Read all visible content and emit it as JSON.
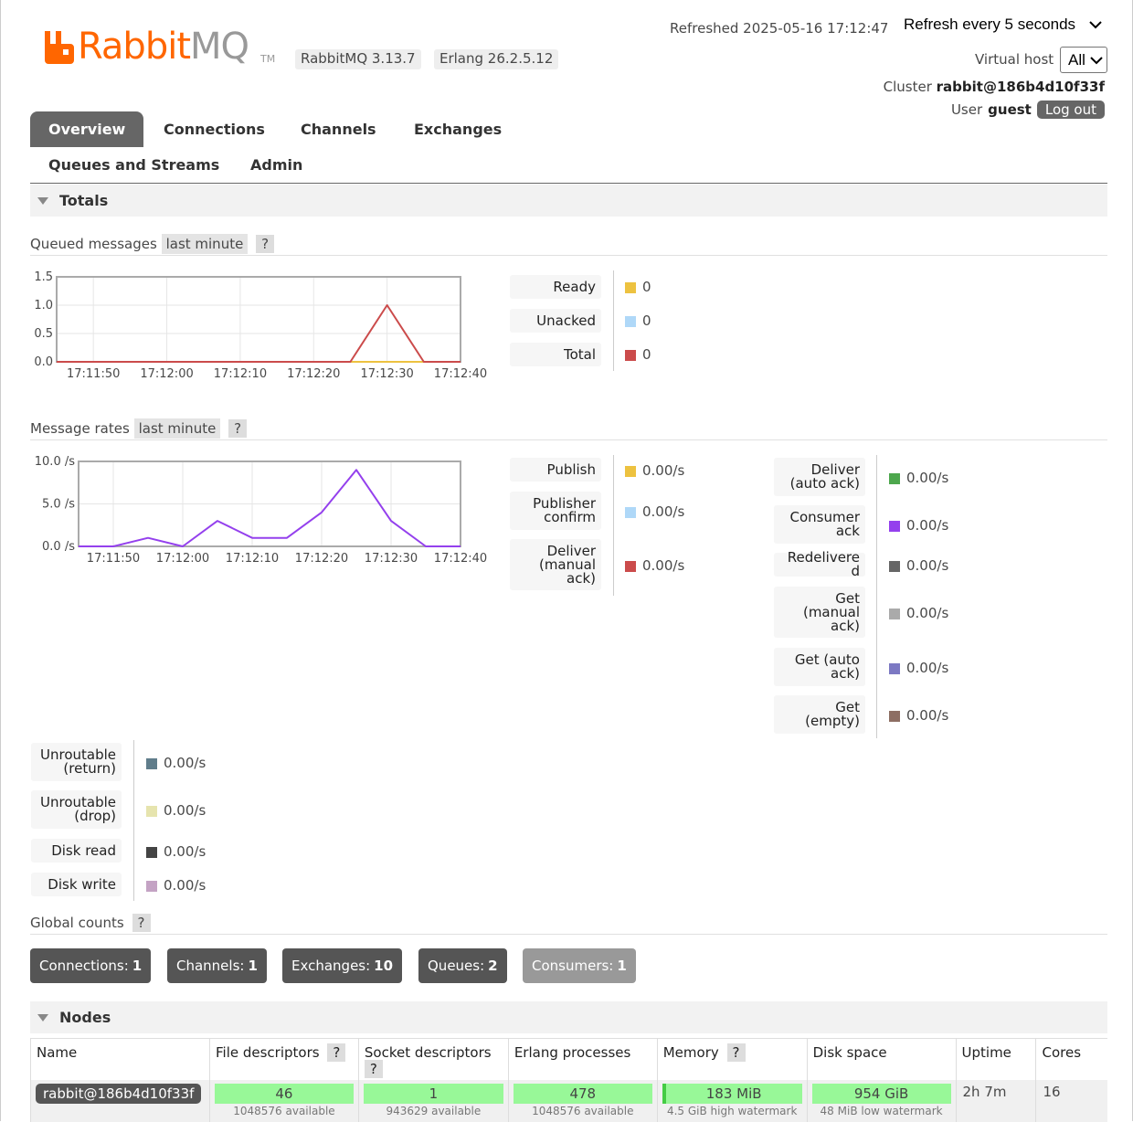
{
  "header": {
    "brand_word1": "Rabbit",
    "brand_word2": "MQ",
    "brand_tm": "TM",
    "rabbitmq_version": "RabbitMQ 3.13.7",
    "erlang_version": "Erlang 26.2.5.12",
    "refreshed_label": "Refreshed 2025-05-16 17:12:47",
    "refresh_option": "Refresh every 5 seconds",
    "vhost_label": "Virtual host",
    "vhost_value": "All",
    "cluster_label": "Cluster",
    "cluster_value": "rabbit@186b4d10f33f",
    "user_label": "User",
    "user_value": "guest",
    "logout_label": "Log out",
    "brand_color": "#ff6600"
  },
  "tabs": [
    {
      "label": "Overview",
      "active": true
    },
    {
      "label": "Connections",
      "active": false
    },
    {
      "label": "Channels",
      "active": false
    },
    {
      "label": "Exchanges",
      "active": false
    },
    {
      "label": "Queues and Streams",
      "active": false
    },
    {
      "label": "Admin",
      "active": false
    }
  ],
  "totals": {
    "title": "Totals",
    "queued": {
      "label": "Queued messages",
      "range": "last minute",
      "help": "?",
      "legend": [
        {
          "label": "Ready",
          "value": "0",
          "color": "#edc240"
        },
        {
          "label": "Unacked",
          "value": "0",
          "color": "#afd8f8"
        },
        {
          "label": "Total",
          "value": "0",
          "color": "#cb4b4b"
        }
      ]
    },
    "rates": {
      "label": "Message rates",
      "range": "last minute",
      "help": "?",
      "legend_left": [
        {
          "label": "Publish",
          "value": "0.00/s",
          "color": "#edc240"
        },
        {
          "label": "Publisher confirm",
          "value": "0.00/s",
          "color": "#afd8f8"
        },
        {
          "label": "Deliver (manual ack)",
          "value": "0.00/s",
          "color": "#cb4b4b"
        }
      ],
      "legend_right": [
        {
          "label": "Deliver (auto ack)",
          "value": "0.00/s",
          "color": "#4da74d"
        },
        {
          "label": "Consumer ack",
          "value": "0.00/s",
          "color": "#9440ed"
        },
        {
          "label": "Redelivered",
          "value": "0.00/s",
          "color": "#666666"
        },
        {
          "label": "Get (manual ack)",
          "value": "0.00/s",
          "color": "#aaaaaa"
        },
        {
          "label": "Get (auto ack)",
          "value": "0.00/s",
          "color": "#7c79c3"
        },
        {
          "label": "Get (empty)",
          "value": "0.00/s",
          "color": "#8d6e63"
        }
      ],
      "legend_bottom": [
        {
          "label": "Unroutable (return)",
          "value": "0.00/s",
          "color": "#607d8b"
        },
        {
          "label": "Unroutable (drop)",
          "value": "0.00/s",
          "color": "#e6e4ae"
        },
        {
          "label": "Disk read",
          "value": "0.00/s",
          "color": "#444444"
        },
        {
          "label": "Disk write",
          "value": "0.00/s",
          "color": "#c4a3c4"
        }
      ]
    },
    "global_counts": {
      "label": "Global counts",
      "help": "?",
      "items": [
        {
          "label": "Connections:",
          "value": "1"
        },
        {
          "label": "Channels:",
          "value": "1"
        },
        {
          "label": "Exchanges:",
          "value": "10"
        },
        {
          "label": "Queues:",
          "value": "2"
        },
        {
          "label": "Consumers:",
          "value": "1"
        }
      ]
    }
  },
  "chart_data": [
    {
      "type": "line",
      "x_tick_labels": [
        "17:11:50",
        "17:12:00",
        "17:12:10",
        "17:12:20",
        "17:12:30",
        "17:12:40"
      ],
      "y_tick_labels": [
        "0.0",
        "0.5",
        "1.0",
        "1.5"
      ],
      "ylim": [
        0,
        1.5
      ],
      "x_seconds_range": [
        0,
        55
      ],
      "series": [
        {
          "name": "Ready",
          "color": "#edc240",
          "x": [
            0,
            40,
            45,
            50,
            55
          ],
          "values": [
            0,
            0,
            0,
            0,
            0
          ]
        },
        {
          "name": "Total",
          "color": "#cb4b4b",
          "x": [
            0,
            40,
            45,
            50,
            55
          ],
          "values": [
            0,
            0,
            1,
            0,
            0
          ]
        }
      ],
      "grid": true
    },
    {
      "type": "line",
      "x_tick_labels": [
        "17:11:50",
        "17:12:00",
        "17:12:10",
        "17:12:20",
        "17:12:30",
        "17:12:40"
      ],
      "y_tick_labels": [
        "0.0 /s",
        "5.0 /s",
        "10.0 /s"
      ],
      "ylim": [
        0,
        10
      ],
      "x_seconds_range": [
        0,
        55
      ],
      "series": [
        {
          "name": "Consumer ack",
          "color": "#9440ed",
          "x": [
            0,
            5,
            10,
            15,
            20,
            25,
            30,
            35,
            40,
            45,
            50,
            55
          ],
          "values": [
            0,
            0,
            1,
            0,
            3,
            1,
            1,
            4,
            9,
            3,
            0,
            0
          ]
        }
      ],
      "grid": true
    }
  ],
  "nodes": {
    "title": "Nodes",
    "columns": [
      {
        "label": "Name",
        "help": false
      },
      {
        "label": "File descriptors",
        "help": true
      },
      {
        "label": "Socket descriptors",
        "help": true
      },
      {
        "label": "Erlang processes",
        "help": false
      },
      {
        "label": "Memory",
        "help": true
      },
      {
        "label": "Disk space",
        "help": false
      },
      {
        "label": "Uptime",
        "help": false
      },
      {
        "label": "Cores",
        "help": false
      }
    ],
    "row": {
      "name": "rabbit@186b4d10f33f",
      "file_descriptors": "46",
      "file_descriptors_sub": "1048576 available",
      "socket_descriptors": "1",
      "socket_descriptors_sub": "943629 available",
      "erlang_processes": "478",
      "erlang_processes_sub": "1048576 available",
      "memory": "183 MiB",
      "memory_sub": "4.5 GiB high watermark",
      "disk_space": "954 GiB",
      "disk_space_sub": "48 MiB low watermark",
      "uptime": "2h 7m",
      "cores": "16"
    }
  }
}
